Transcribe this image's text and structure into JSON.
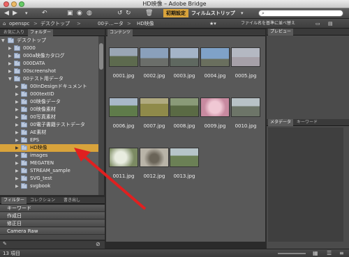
{
  "window": {
    "title": "HD映像 – Adobe Bridge"
  },
  "toolbar": {
    "workspace_active": "初期設定",
    "workspace_item": "フィルムストリップ",
    "workspace_menu_icon": "chevron-down-icon",
    "search_placeholder": ""
  },
  "breadcrumb": {
    "items": [
      "openspc",
      "デスクトップ",
      "00テ…ータ",
      "HD映像"
    ],
    "sort_label": "ファイル名を基準に並べ替え"
  },
  "left_panel": {
    "tabs": [
      "お気に入り",
      "フォルダー"
    ],
    "folders": [
      {
        "label": "デスクトップ",
        "indent": 0,
        "expanded": true,
        "selected": false
      },
      {
        "label": "0000",
        "indent": 1,
        "expanded": false,
        "selected": false
      },
      {
        "label": "000a映像カタログ",
        "indent": 1,
        "expanded": false,
        "selected": false
      },
      {
        "label": "000DATA",
        "indent": 1,
        "expanded": false,
        "selected": false
      },
      {
        "label": "00screenshot",
        "indent": 1,
        "expanded": false,
        "selected": false
      },
      {
        "label": "00テスト用データ",
        "indent": 1,
        "expanded": true,
        "selected": false
      },
      {
        "label": "00InDesignドキュメント",
        "indent": 2,
        "expanded": false,
        "selected": false
      },
      {
        "label": "000textID",
        "indent": 2,
        "expanded": false,
        "selected": false
      },
      {
        "label": "00映像データ",
        "indent": 2,
        "expanded": false,
        "selected": false
      },
      {
        "label": "00映像素材",
        "indent": 2,
        "expanded": false,
        "selected": false
      },
      {
        "label": "00写真素材",
        "indent": 2,
        "expanded": false,
        "selected": false
      },
      {
        "label": "00電子書籍テストデータ",
        "indent": 2,
        "expanded": false,
        "selected": false
      },
      {
        "label": "AE素材",
        "indent": 2,
        "expanded": false,
        "selected": false
      },
      {
        "label": "EPS",
        "indent": 2,
        "expanded": false,
        "selected": false
      },
      {
        "label": "HD映像",
        "indent": 2,
        "expanded": false,
        "selected": true
      },
      {
        "label": "images",
        "indent": 2,
        "expanded": false,
        "selected": false
      },
      {
        "label": "MEGATEN",
        "indent": 2,
        "expanded": false,
        "selected": false
      },
      {
        "label": "STREAM_sample",
        "indent": 2,
        "expanded": false,
        "selected": false
      },
      {
        "label": "SVG_test",
        "indent": 2,
        "expanded": false,
        "selected": false
      },
      {
        "label": "svgbook",
        "indent": 2,
        "expanded": false,
        "selected": false
      }
    ],
    "filter_tabs": [
      "フィルター",
      "コレクション",
      "書き出し"
    ],
    "filter_rows": [
      "キーワード",
      "作成日",
      "修正日",
      "Camera Raw"
    ]
  },
  "content": {
    "tab": "コンテンツ",
    "items": [
      {
        "name": "0001.jpg",
        "color": "#7f8a7a"
      },
      {
        "name": "0002.jpg",
        "color": "#8a9aa6"
      },
      {
        "name": "0003.jpg",
        "color": "#9aa0a8"
      },
      {
        "name": "0004.jpg",
        "color": "#86a0b8"
      },
      {
        "name": "0005.jpg",
        "color": "#a8a6b0"
      },
      {
        "name": "0006.jpg",
        "color": "#6f8b5e"
      },
      {
        "name": "0007.jpg",
        "color": "#8f8a55"
      },
      {
        "name": "0008.jpg",
        "color": "#6b7a5a"
      },
      {
        "name": "0009.jpg",
        "color": "#d8a8b8"
      },
      {
        "name": "0010.jpg",
        "color": "#8a9090"
      },
      {
        "name": "0011.jpg",
        "color": "#b8bcb0"
      },
      {
        "name": "0012.jpg",
        "color": "#8d8a80"
      },
      {
        "name": "0013.jpg",
        "color": "#7b8f6a"
      }
    ]
  },
  "right_panel": {
    "preview_tab": "プレビュー",
    "meta_tabs": [
      "メタデータ",
      "キーワード"
    ]
  },
  "status": {
    "count": "13 項目"
  },
  "colors": {
    "selection": "#d9a33b",
    "annotation_arrow": "#e02020"
  }
}
